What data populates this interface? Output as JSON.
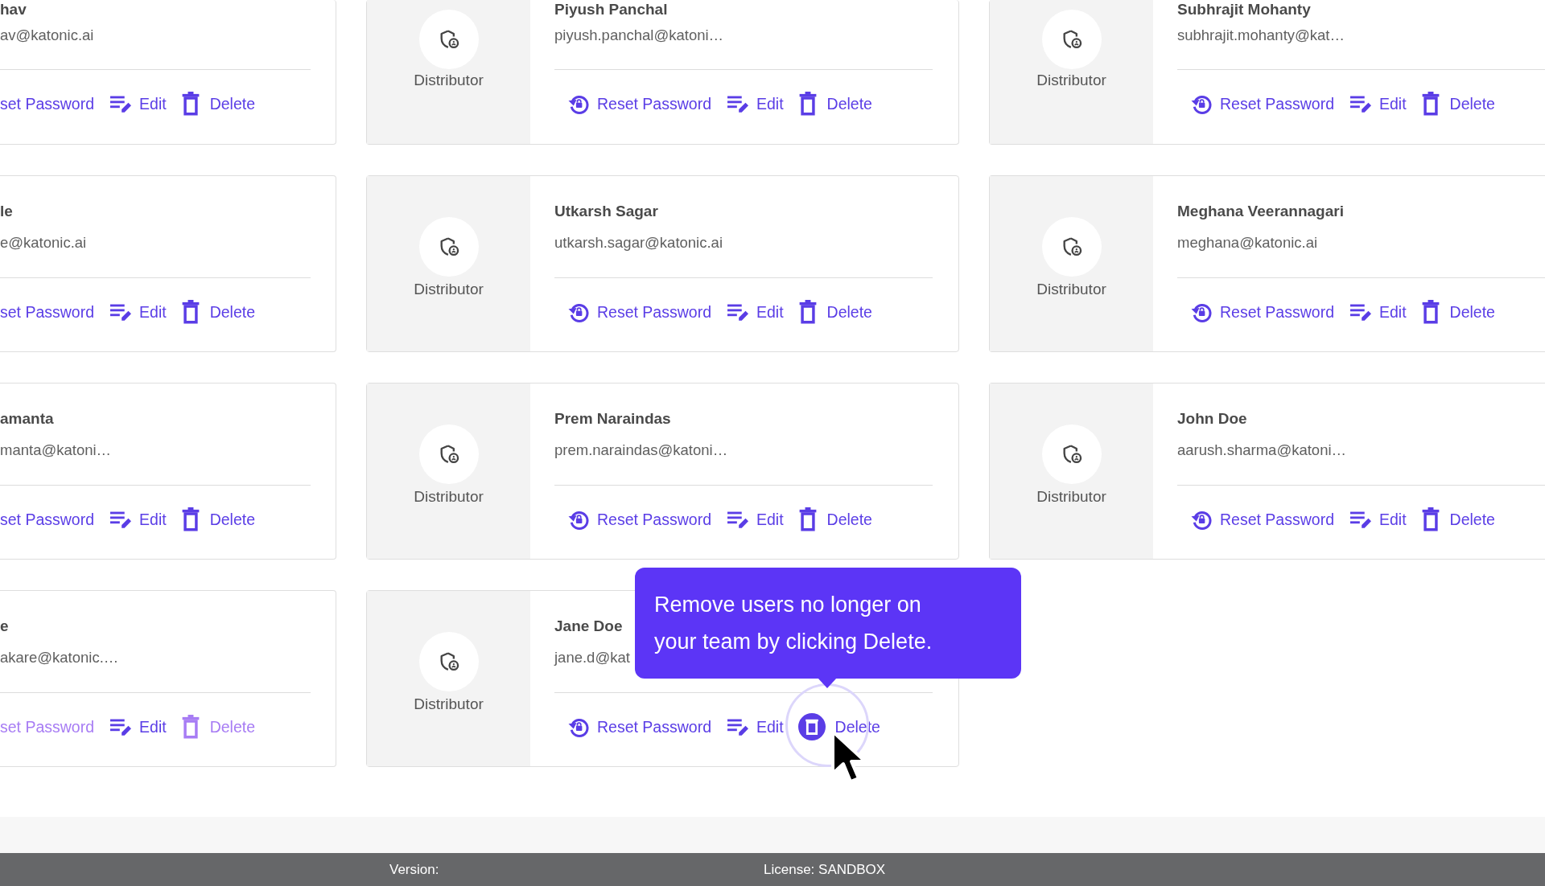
{
  "rows": [
    {
      "cards": [
        {
          "name": "hav",
          "email": "av@katonic.ai",
          "actions": [
            {
              "kind": "reset",
              "label": "set Password",
              "dimmed": false,
              "highlighted": false
            },
            {
              "kind": "edit",
              "label": "Edit",
              "dimmed": false,
              "highlighted": false
            },
            {
              "kind": "delete",
              "label": "Delete",
              "dimmed": false,
              "highlighted": false
            }
          ]
        },
        {
          "role": "Distributor",
          "name": "Piyush Panchal",
          "email": "piyush.panchal@katoni…",
          "actions": [
            {
              "kind": "reset",
              "label": "Reset Password",
              "dimmed": false,
              "highlighted": false
            },
            {
              "kind": "edit",
              "label": "Edit",
              "dimmed": false,
              "highlighted": false
            },
            {
              "kind": "delete",
              "label": "Delete",
              "dimmed": false,
              "highlighted": false
            }
          ]
        },
        {
          "role": "Distributor",
          "name": "Subhrajit Mohanty",
          "email": "subhrajit.mohanty@kat…",
          "actions": [
            {
              "kind": "reset",
              "label": "Reset Password",
              "dimmed": false,
              "highlighted": false
            },
            {
              "kind": "edit",
              "label": "Edit",
              "dimmed": false,
              "highlighted": false
            },
            {
              "kind": "delete",
              "label": "Delete",
              "dimmed": false,
              "highlighted": false
            }
          ]
        }
      ]
    },
    {
      "cards": [
        {
          "name": "le",
          "email": "e@katonic.ai",
          "actions": [
            {
              "kind": "reset",
              "label": "set Password",
              "dimmed": false,
              "highlighted": false
            },
            {
              "kind": "edit",
              "label": "Edit",
              "dimmed": false,
              "highlighted": false
            },
            {
              "kind": "delete",
              "label": "Delete",
              "dimmed": false,
              "highlighted": false
            }
          ]
        },
        {
          "role": "Distributor",
          "name": "Utkarsh Sagar",
          "email": "utkarsh.sagar@katonic.ai",
          "actions": [
            {
              "kind": "reset",
              "label": "Reset Password",
              "dimmed": false,
              "highlighted": false
            },
            {
              "kind": "edit",
              "label": "Edit",
              "dimmed": false,
              "highlighted": false
            },
            {
              "kind": "delete",
              "label": "Delete",
              "dimmed": false,
              "highlighted": false
            }
          ]
        },
        {
          "role": "Distributor",
          "name": "Meghana Veerannagari",
          "email": "meghana@katonic.ai",
          "actions": [
            {
              "kind": "reset",
              "label": "Reset Password",
              "dimmed": false,
              "highlighted": false
            },
            {
              "kind": "edit",
              "label": "Edit",
              "dimmed": false,
              "highlighted": false
            },
            {
              "kind": "delete",
              "label": "Delete",
              "dimmed": false,
              "highlighted": false
            }
          ]
        }
      ]
    },
    {
      "cards": [
        {
          "name": "amanta",
          "email": "manta@katoni…",
          "actions": [
            {
              "kind": "reset",
              "label": "set Password",
              "dimmed": false,
              "highlighted": false
            },
            {
              "kind": "edit",
              "label": "Edit",
              "dimmed": false,
              "highlighted": false
            },
            {
              "kind": "delete",
              "label": "Delete",
              "dimmed": false,
              "highlighted": false
            }
          ]
        },
        {
          "role": "Distributor",
          "name": "Prem Naraindas",
          "email": "prem.naraindas@katoni…",
          "actions": [
            {
              "kind": "reset",
              "label": "Reset Password",
              "dimmed": false,
              "highlighted": false
            },
            {
              "kind": "edit",
              "label": "Edit",
              "dimmed": false,
              "highlighted": false
            },
            {
              "kind": "delete",
              "label": "Delete",
              "dimmed": false,
              "highlighted": false
            }
          ]
        },
        {
          "role": "Distributor",
          "name": "John Doe",
          "email": "aarush.sharma@katoni…",
          "actions": [
            {
              "kind": "reset",
              "label": "Reset Password",
              "dimmed": false,
              "highlighted": false
            },
            {
              "kind": "edit",
              "label": "Edit",
              "dimmed": false,
              "highlighted": false
            },
            {
              "kind": "delete",
              "label": "Delete",
              "dimmed": false,
              "highlighted": false
            }
          ]
        }
      ]
    },
    {
      "cards": [
        {
          "name": "e",
          "email": "akare@katonic.…",
          "actions": [
            {
              "kind": "reset",
              "label": "set Password",
              "dimmed": true,
              "highlighted": false
            },
            {
              "kind": "edit",
              "label": "Edit",
              "dimmed": false,
              "highlighted": false
            },
            {
              "kind": "delete",
              "label": "Delete",
              "dimmed": true,
              "highlighted": false
            }
          ]
        },
        {
          "role": "Distributor",
          "name": "Jane Doe",
          "email": "jane.d@kat",
          "actions": [
            {
              "kind": "reset",
              "label": "Reset Password",
              "dimmed": false,
              "highlighted": false
            },
            {
              "kind": "edit",
              "label": "Edit",
              "dimmed": false,
              "highlighted": false
            },
            {
              "kind": "delete",
              "label": "Delete",
              "dimmed": false,
              "highlighted": true
            }
          ]
        }
      ]
    }
  ],
  "tooltip": {
    "text": "Remove users no longer on your team by clicking Delete."
  },
  "footer": {
    "version": "Version:",
    "license": "License: SANDBOX"
  }
}
